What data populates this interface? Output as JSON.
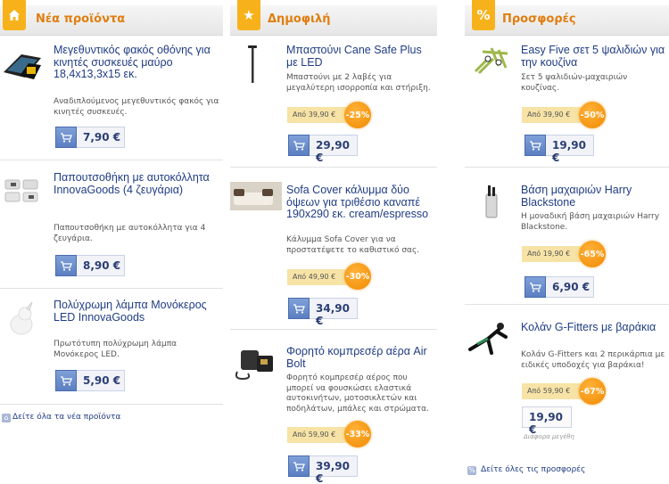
{
  "columns": {
    "new": {
      "title": "Νέα προϊόντα",
      "icon": "home-icon",
      "footer": "Δείτε όλα τα νέα προϊόντα",
      "products": [
        {
          "title": "Μεγεθυντικός φακός οθόνης για κινητές συσκευές μαύρο 18,4x13,3x15 εκ.",
          "desc": "Αναδιπλούμενος μεγεθυντικός φακός για κινητές συσκευές.",
          "price": "7,90 €"
        },
        {
          "title": "Παπουτσοθήκη με αυτοκόλλητα InnovaGoods (4 ζευγάρια)",
          "desc": "Παπουτσοθήκη με αυτοκόλλητα για 4 ζευγάρια.",
          "price": "8,90 €"
        },
        {
          "title": "Πολύχρωμη λάμπα Μονόκερος LED InnovaGoods",
          "desc": "Πρωτότυπη πολύχρωμη λάμπα Μονόκερος LED.",
          "price": "5,90 €"
        }
      ]
    },
    "popular": {
      "title": "Δημοφιλή",
      "icon": "star-icon",
      "products": [
        {
          "title": "Μπαστούνι Cane Safe Plus με LED",
          "desc": "Μπαστούνι με 2 λαβές για μεγαλύτερη ισορροπία και στήριξη.",
          "old_price": "Από 39,90 €",
          "discount": "-25%",
          "price": "29,90 €"
        },
        {
          "title": "Sofa Cover κάλυμμα δύο όψεων για τριθέσιο καναπέ 190x290 εκ. cream/espresso",
          "desc": "Κάλυμμα Sofa Cover για να προστατέψετε το καθιστικό σας.",
          "old_price": "Από 49,90 €",
          "discount": "-30%",
          "price": "34,90 €"
        },
        {
          "title": "Φορητό κομπρεσέρ αέρα Air Bolt",
          "desc": "Φορητό κομπρεσέρ αέρος που μπορεί να φουσκώσει ελαστικά αυτοκινήτων, μοτοσικλετών και ποδηλάτων, μπάλες και στρώματα.",
          "old_price": "Από 59,90 €",
          "discount": "-33%",
          "price": "39,90 €"
        }
      ]
    },
    "offers": {
      "title": "Προσφορές",
      "icon": "percent-icon",
      "footer": "Δείτε όλες τις προσφορές",
      "products": [
        {
          "title": "Easy Five σετ 5 ψαλιδιών για την κουζίνα",
          "desc": "Σετ 5 ψαλιδιών-μαχαιριών κουζίνας.",
          "old_price": "Από 39,90 €",
          "discount": "-50%",
          "price": "19,90 €"
        },
        {
          "title": "Βάση μαχαιριών Harry Blackstone",
          "desc": "Η μοναδική βάση μαχαιριών Harry Blackstone.",
          "old_price": "Από 19,90 €",
          "discount": "-65%",
          "price": "6,90 €"
        },
        {
          "title": "Κολάν G-Fitters με βαράκια",
          "desc": "Κολάν G-Fitters και 2 περικάρπια με ειδικές υποδοχές για βαράκια!",
          "old_price": "Από 59,90 €",
          "discount": "-67%",
          "price": "19,90 €",
          "note": "Διάφορα μεγέθη"
        }
      ]
    }
  },
  "colors": {
    "accent": "#f7b21b",
    "title": "#e07e10",
    "link": "#1f3c84",
    "discount": "#f08a00"
  }
}
